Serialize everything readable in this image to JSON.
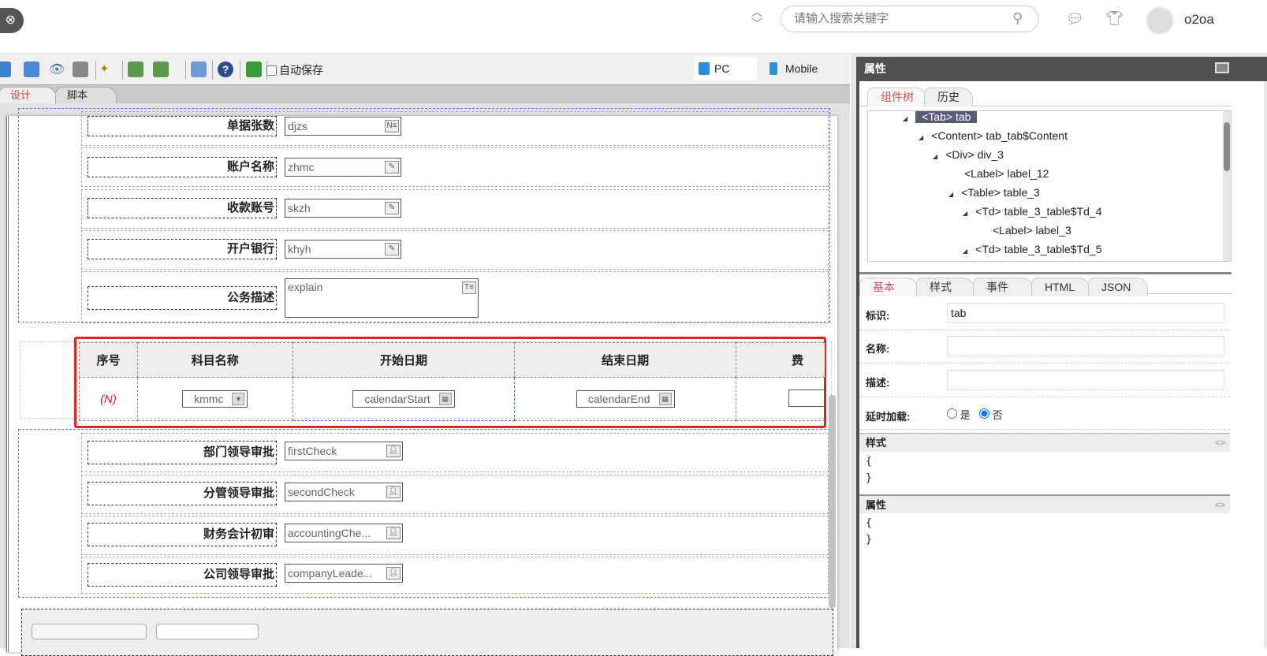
{
  "topbar": {
    "search_placeholder": "请输入搜索关键字",
    "username": "o2oa"
  },
  "toolbar": {
    "autosave_label": "自动保存",
    "autosave_checked": false,
    "pc_label": "PC",
    "mobile_label": "Mobile"
  },
  "editor_tabs": [
    {
      "label": "设计",
      "active": true
    },
    {
      "label": "脚本",
      "active": false
    }
  ],
  "form_rows_top": [
    {
      "label": "单据张数",
      "field": "djzs",
      "icon": "N≡"
    },
    {
      "label": "账户名称",
      "field": "zhmc",
      "icon": "✎"
    },
    {
      "label": "收款账号",
      "field": "skzh",
      "icon": "✎"
    },
    {
      "label": "开户银行",
      "field": "khyh",
      "icon": "✎"
    },
    {
      "label": "公务描述",
      "field": "explain",
      "icon": "T≡"
    }
  ],
  "grid": {
    "headers": [
      "序号",
      "科目名称",
      "开始日期",
      "结束日期",
      "费"
    ],
    "row": {
      "index": "(N)",
      "kmmc": "kmmc",
      "start": "calendarStart",
      "end": "calendarEnd"
    }
  },
  "form_rows_bottom": [
    {
      "label": "部门领导审批",
      "field": "firstCheck"
    },
    {
      "label": "分管领导审批",
      "field": "secondCheck"
    },
    {
      "label": "财务会计初审",
      "field": "accountingChe..."
    },
    {
      "label": "公司领导审批",
      "field": "companyLeade..."
    }
  ],
  "panel": {
    "title": "属性",
    "tree_tabs": [
      "组件树",
      "历史"
    ],
    "tree": [
      "<Tab> tab",
      "<Content> tab_tab$Content",
      "<Div> div_3",
      "<Label> label_12",
      "<Table> table_3",
      "<Td> table_3_table$Td_4",
      "<Label> label_3",
      "<Td> table_3_table$Td_5"
    ],
    "prop_tabs": [
      "基本",
      "样式",
      "事件",
      "HTML",
      "JSON"
    ],
    "fields": {
      "id_label": "标识:",
      "id_value": "tab",
      "name_label": "名称:",
      "desc_label": "描述:",
      "lazy_label": "延时加载:",
      "yes": "是",
      "no": "否",
      "lazy_value": "否"
    },
    "style_title": "样式",
    "attr_title": "属性",
    "brace_open": "{",
    "brace_close": "}",
    "code_toggle": "<>"
  }
}
